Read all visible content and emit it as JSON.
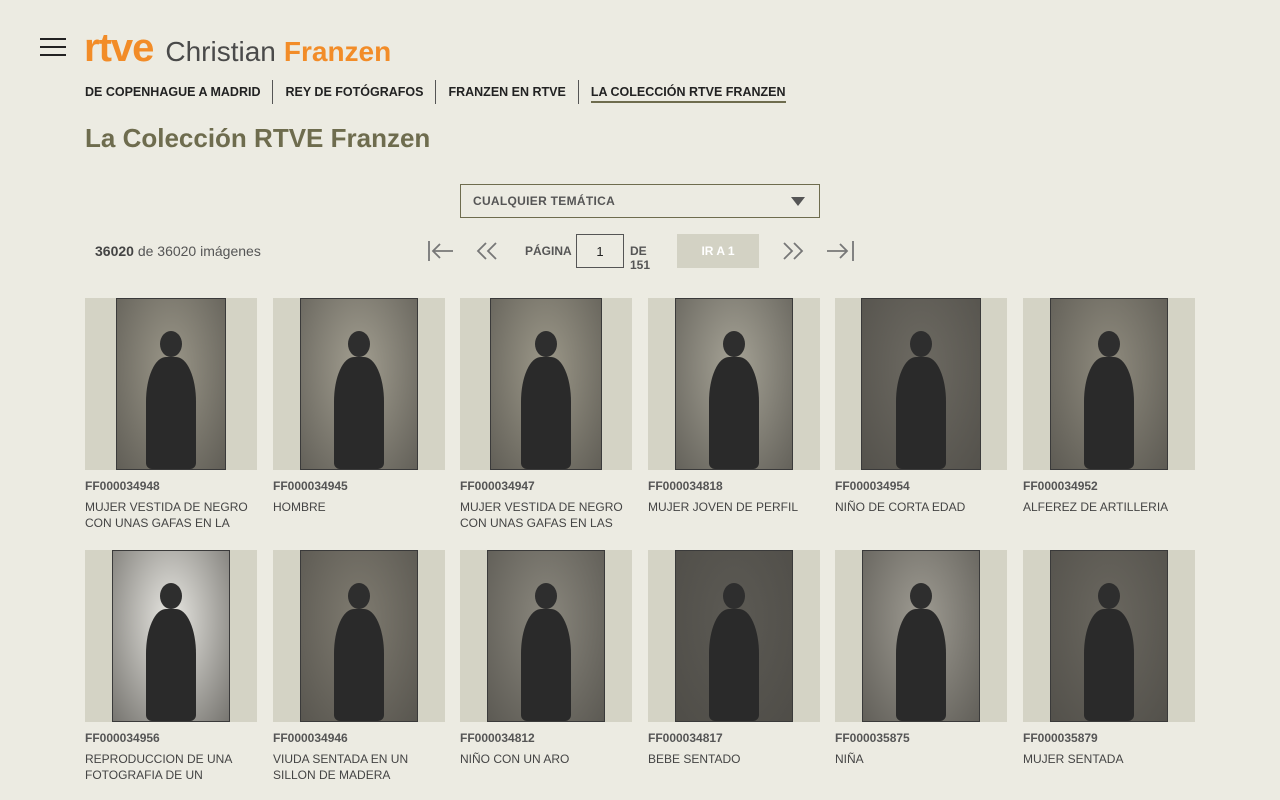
{
  "brand": {
    "logo": "rtve",
    "site_first": "Christian",
    "site_last": "Franzen"
  },
  "nav": [
    {
      "label": "DE COPENHAGUE A MADRID"
    },
    {
      "label": "REY DE FOTÓGRAFOS"
    },
    {
      "label": "FRANZEN EN RTVE"
    },
    {
      "label": "LA COLECCIÓN RTVE FRANZEN",
      "active": true
    }
  ],
  "page_title": "La Colección RTVE Franzen",
  "filter": {
    "selected": "CUALQUIER TEMÁTICA"
  },
  "count": {
    "shown": "36020",
    "rest": "de 36020 imágenes"
  },
  "pagination": {
    "page_label": "PÁGINA",
    "page_value": "1",
    "of_label": "DE 151",
    "go_label": "IR A 1"
  },
  "colors": {
    "accent": "#f28c28",
    "olive": "#6e6c4e",
    "background": "#ecebe2",
    "thumb_bg": "#d4d3c5"
  },
  "items": [
    {
      "code": "FF000034948",
      "title": "MUJER VESTIDA DE NEGRO CON UNAS GAFAS EN LA",
      "tone": "#9a9688"
    },
    {
      "code": "FF000034945",
      "title": "HOMBRE",
      "tone": "#a29e90"
    },
    {
      "code": "FF000034947",
      "title": "MUJER VESTIDA DE NEGRO CON UNAS GAFAS EN LAS",
      "tone": "#9c9889"
    },
    {
      "code": "FF000034818",
      "title": "MUJER JOVEN DE PERFIL",
      "tone": "#a6a396"
    },
    {
      "code": "FF000034954",
      "title": "NIÑO DE CORTA EDAD",
      "tone": "#6d6a62"
    },
    {
      "code": "FF000034952",
      "title": "ALFEREZ DE ARTILLERIA",
      "tone": "#8f8b7e"
    },
    {
      "code": "FF000034956",
      "title": "REPRODUCCION DE UNA FOTOGRAFIA DE UN HOMBRE",
      "tone": "#e8e7e2"
    },
    {
      "code": "FF000034946",
      "title": "VIUDA SENTADA EN UN SILLON DE MADERA LABRADA",
      "tone": "#7f7b70"
    },
    {
      "code": "FF000034812",
      "title": "NIÑO CON UN ARO",
      "tone": "#8a877d"
    },
    {
      "code": "FF000034817",
      "title": "BEBE SENTADO",
      "tone": "#5c5a54"
    },
    {
      "code": "FF000035875",
      "title": "NIÑA",
      "tone": "#9e9b92"
    },
    {
      "code": "FF000035879",
      "title": "MUJER SENTADA",
      "tone": "#6a675f"
    }
  ]
}
